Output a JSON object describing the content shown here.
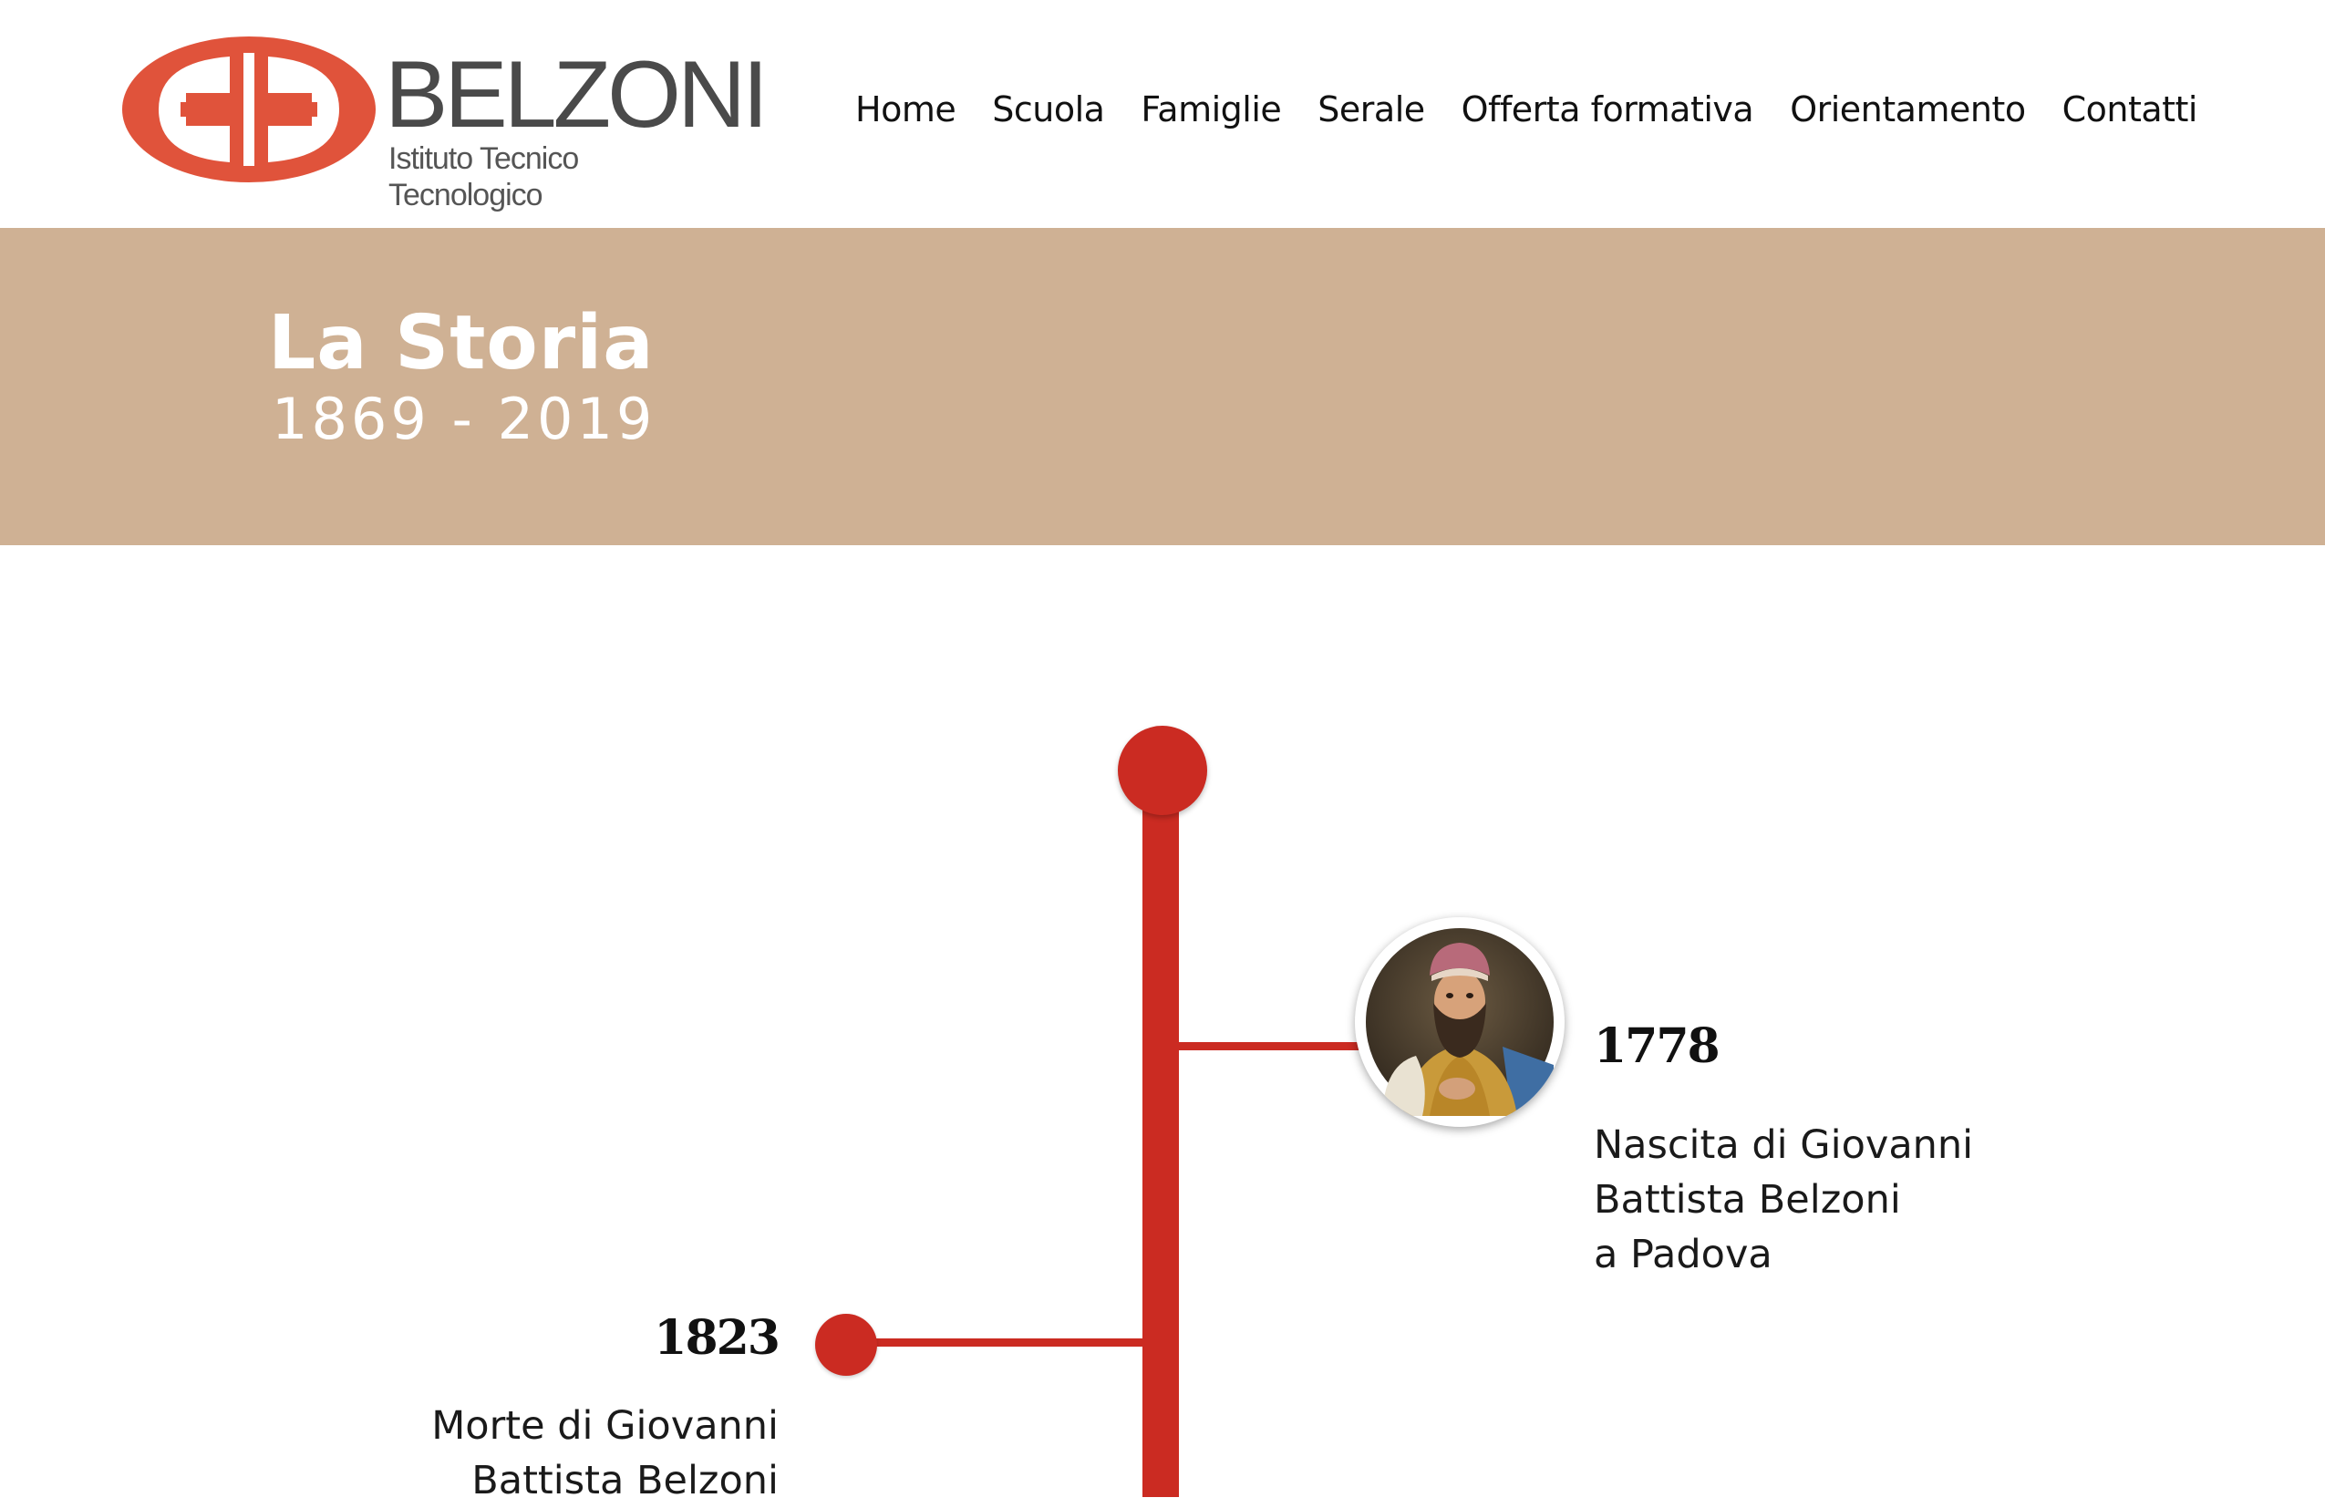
{
  "header": {
    "logo": {
      "name": "BELZONI",
      "subtitle": "Istituto Tecnico Tecnologico",
      "mark_icon": "belzoni-logo-mark",
      "mark_color": "#e0533b"
    },
    "nav": [
      {
        "label": "Home"
      },
      {
        "label": "Scuola"
      },
      {
        "label": "Famiglie"
      },
      {
        "label": "Serale"
      },
      {
        "label": "Offerta formativa"
      },
      {
        "label": "Orientamento"
      },
      {
        "label": "Contatti"
      }
    ]
  },
  "banner": {
    "title": "La Storia",
    "years": "1869 - 2019",
    "background_color": "#cfb194"
  },
  "timeline": {
    "line_color": "#cb2b22",
    "events": [
      {
        "year": "1778",
        "lines": [
          "Nascita di Giovanni",
          "Battista Belzoni",
          "a Padova"
        ],
        "image": "portrait-of-giovanni-battista-belzoni"
      },
      {
        "year": "1823",
        "lines": [
          "Morte di Giovanni",
          "Battista Belzoni"
        ]
      }
    ]
  }
}
